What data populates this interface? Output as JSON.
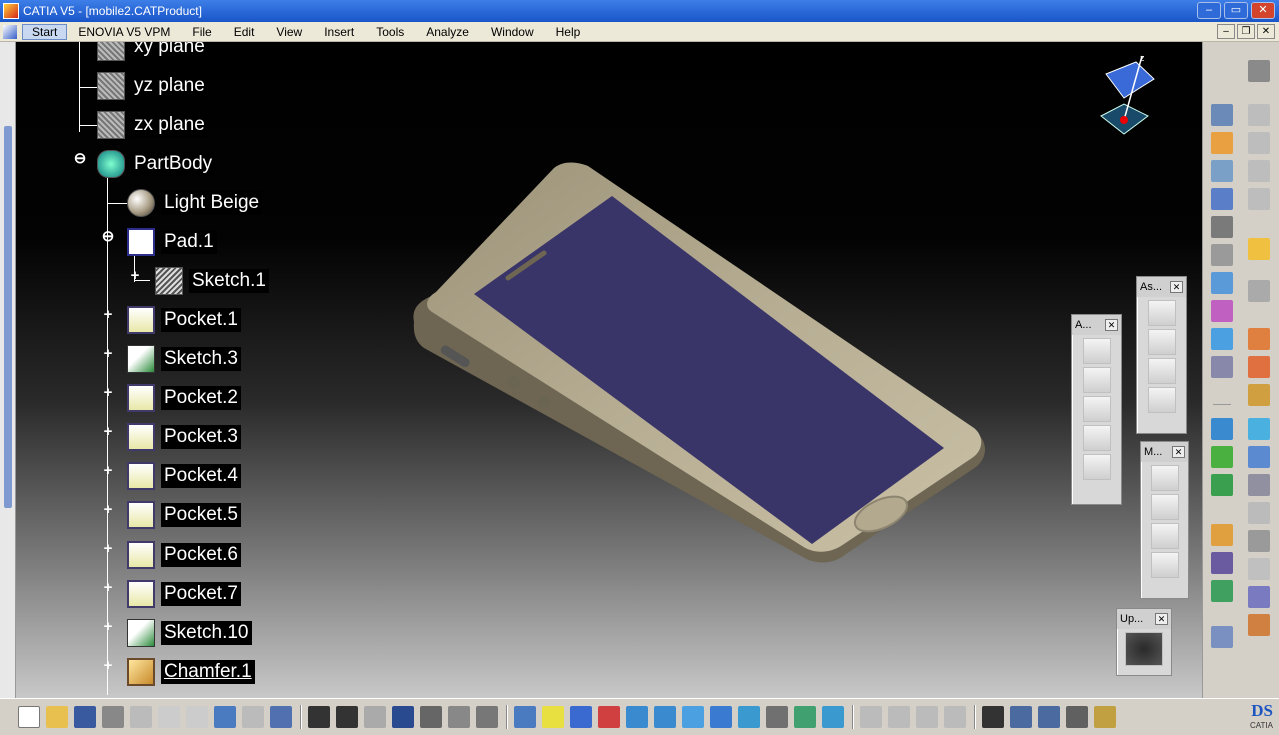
{
  "window": {
    "title": "CATIA V5 - [mobile2.CATProduct]",
    "buttons": [
      "–",
      "▭",
      "✕"
    ]
  },
  "menu": {
    "start": "Start",
    "items": [
      "ENOVIA V5 VPM",
      "File",
      "Edit",
      "View",
      "Insert",
      "Tools",
      "Analyze",
      "Window",
      "Help"
    ]
  },
  "tree": [
    {
      "label": "xy plane",
      "icon": "plane"
    },
    {
      "label": "yz plane",
      "icon": "plane"
    },
    {
      "label": "zx plane",
      "icon": "plane"
    },
    {
      "label": "PartBody",
      "icon": "body",
      "expander": "minus"
    },
    {
      "label": "Light Beige",
      "icon": "light"
    },
    {
      "label": "Pad.1",
      "icon": "pad",
      "expander": "minus"
    },
    {
      "label": "Sketch.1",
      "icon": "sketch",
      "expander": "plus"
    },
    {
      "label": "Pocket.1",
      "icon": "pocket",
      "expander": "plus"
    },
    {
      "label": "Sketch.3",
      "icon": "sketch3",
      "expander": "plus"
    },
    {
      "label": "Pocket.2",
      "icon": "pocket",
      "expander": "plus"
    },
    {
      "label": "Pocket.3",
      "icon": "pocket",
      "expander": "plus"
    },
    {
      "label": "Pocket.4",
      "icon": "pocket",
      "expander": "plus"
    },
    {
      "label": "Pocket.5",
      "icon": "pocket",
      "expander": "plus"
    },
    {
      "label": "Pocket.6",
      "icon": "pocket",
      "expander": "plus"
    },
    {
      "label": "Pocket.7",
      "icon": "pocket",
      "expander": "plus"
    },
    {
      "label": "Sketch.10",
      "icon": "sketch3",
      "expander": "plus"
    },
    {
      "label": "Chamfer.1",
      "icon": "chamfer",
      "expander": "plus",
      "underlined": true
    }
  ],
  "toolbars": {
    "annotations": {
      "title": "A..."
    },
    "assembly": {
      "title": "As..."
    },
    "measure": {
      "title": "M..."
    },
    "update": {
      "title": "Up..."
    }
  },
  "compass": {
    "axis_label": "z"
  },
  "colors": {
    "phone_body": "#a99f85",
    "phone_screen": "#3a3568",
    "viewport_top": "#000000",
    "title_blue": "#1955c8"
  },
  "logo": {
    "text": "CATIA"
  }
}
